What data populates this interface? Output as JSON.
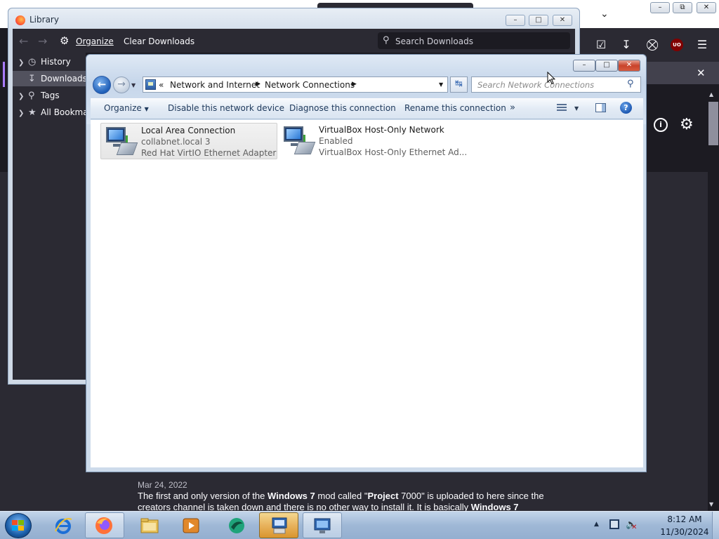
{
  "firefox": {
    "toolbar_icons": [
      "pocket-icon",
      "download-icon",
      "extensions-icon",
      "ublock-icon",
      "menu-icon"
    ],
    "ublock_badge": "UO",
    "article": {
      "date": "Mar 24, 2022",
      "desc_part1": "The first and only version of the ",
      "desc_bold1": "Windows 7",
      "desc_part2": " mod called \"",
      "desc_bold2": "Project",
      "desc_part3": " 7000\" is uploaded to here since the creators channel is taken down and there is no other way to install it. It is basically ",
      "desc_bold3": "Windows 7"
    }
  },
  "library": {
    "title": "Library",
    "toolbar": {
      "organize_label": "Organize",
      "clear_label": "Clear Downloads",
      "search_placeholder": "Search Downloads"
    },
    "tree": [
      {
        "label": "History",
        "icon": "clock-icon"
      },
      {
        "label": "Downloads",
        "icon": "download-icon",
        "selected": true
      },
      {
        "label": "Tags",
        "icon": "tag-icon"
      },
      {
        "label": "All Bookmarks",
        "icon": "star-icon"
      }
    ]
  },
  "netwin": {
    "breadcrumb": {
      "overflow": "«",
      "items": [
        "Network and Internet",
        "Network Connections"
      ]
    },
    "search_placeholder": "Search Network Connections",
    "commands": {
      "organize": "Organize",
      "disable": "Disable this network device",
      "diagnose": "Diagnose this connection",
      "rename": "Rename this connection",
      "more": "»"
    },
    "connections": [
      {
        "name": "Local Area Connection",
        "status": "collabnet.local  3",
        "adapter": "Red Hat VirtIO Ethernet Adapter",
        "selected": true
      },
      {
        "name": "VirtualBox Host-Only Network",
        "status": "Enabled",
        "adapter": "VirtualBox Host-Only Ethernet Ad...",
        "selected": false
      }
    ]
  },
  "taskbar": {
    "apps": [
      "internet-explorer",
      "firefox",
      "file-explorer",
      "media-player",
      "windows-live",
      "control-panel",
      "network-connections"
    ],
    "clock_time": "8:12 AM",
    "clock_date": "11/30/2024"
  }
}
